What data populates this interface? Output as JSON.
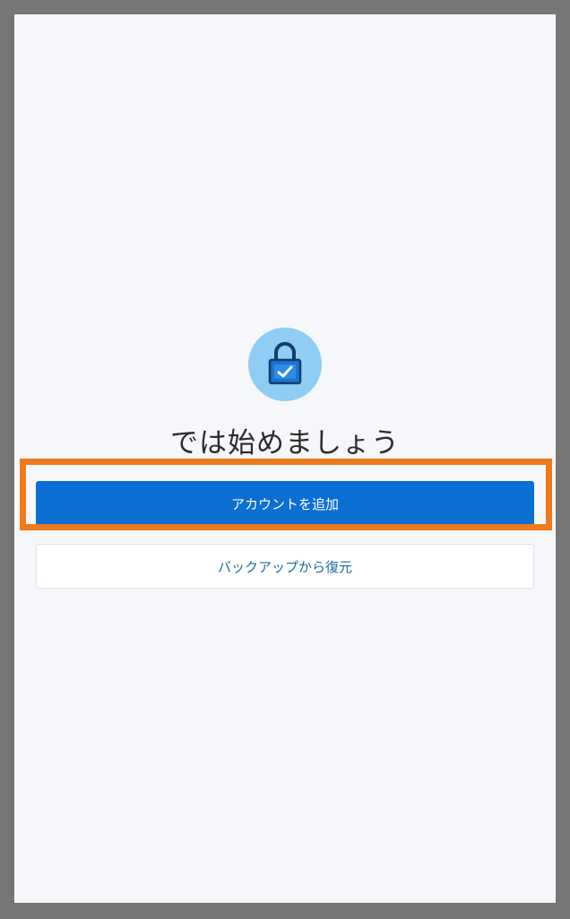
{
  "welcome": {
    "title": "では始めましょう",
    "icon": "lock-check-icon"
  },
  "actions": {
    "add_account_label": "アカウントを追加",
    "restore_backup_label": "バックアップから復元"
  },
  "colors": {
    "primary": "#0b6fd4",
    "highlight": "#ee7a1e",
    "icon_bg": "#8fcdf4",
    "icon_fg": "#1b5fb3"
  }
}
